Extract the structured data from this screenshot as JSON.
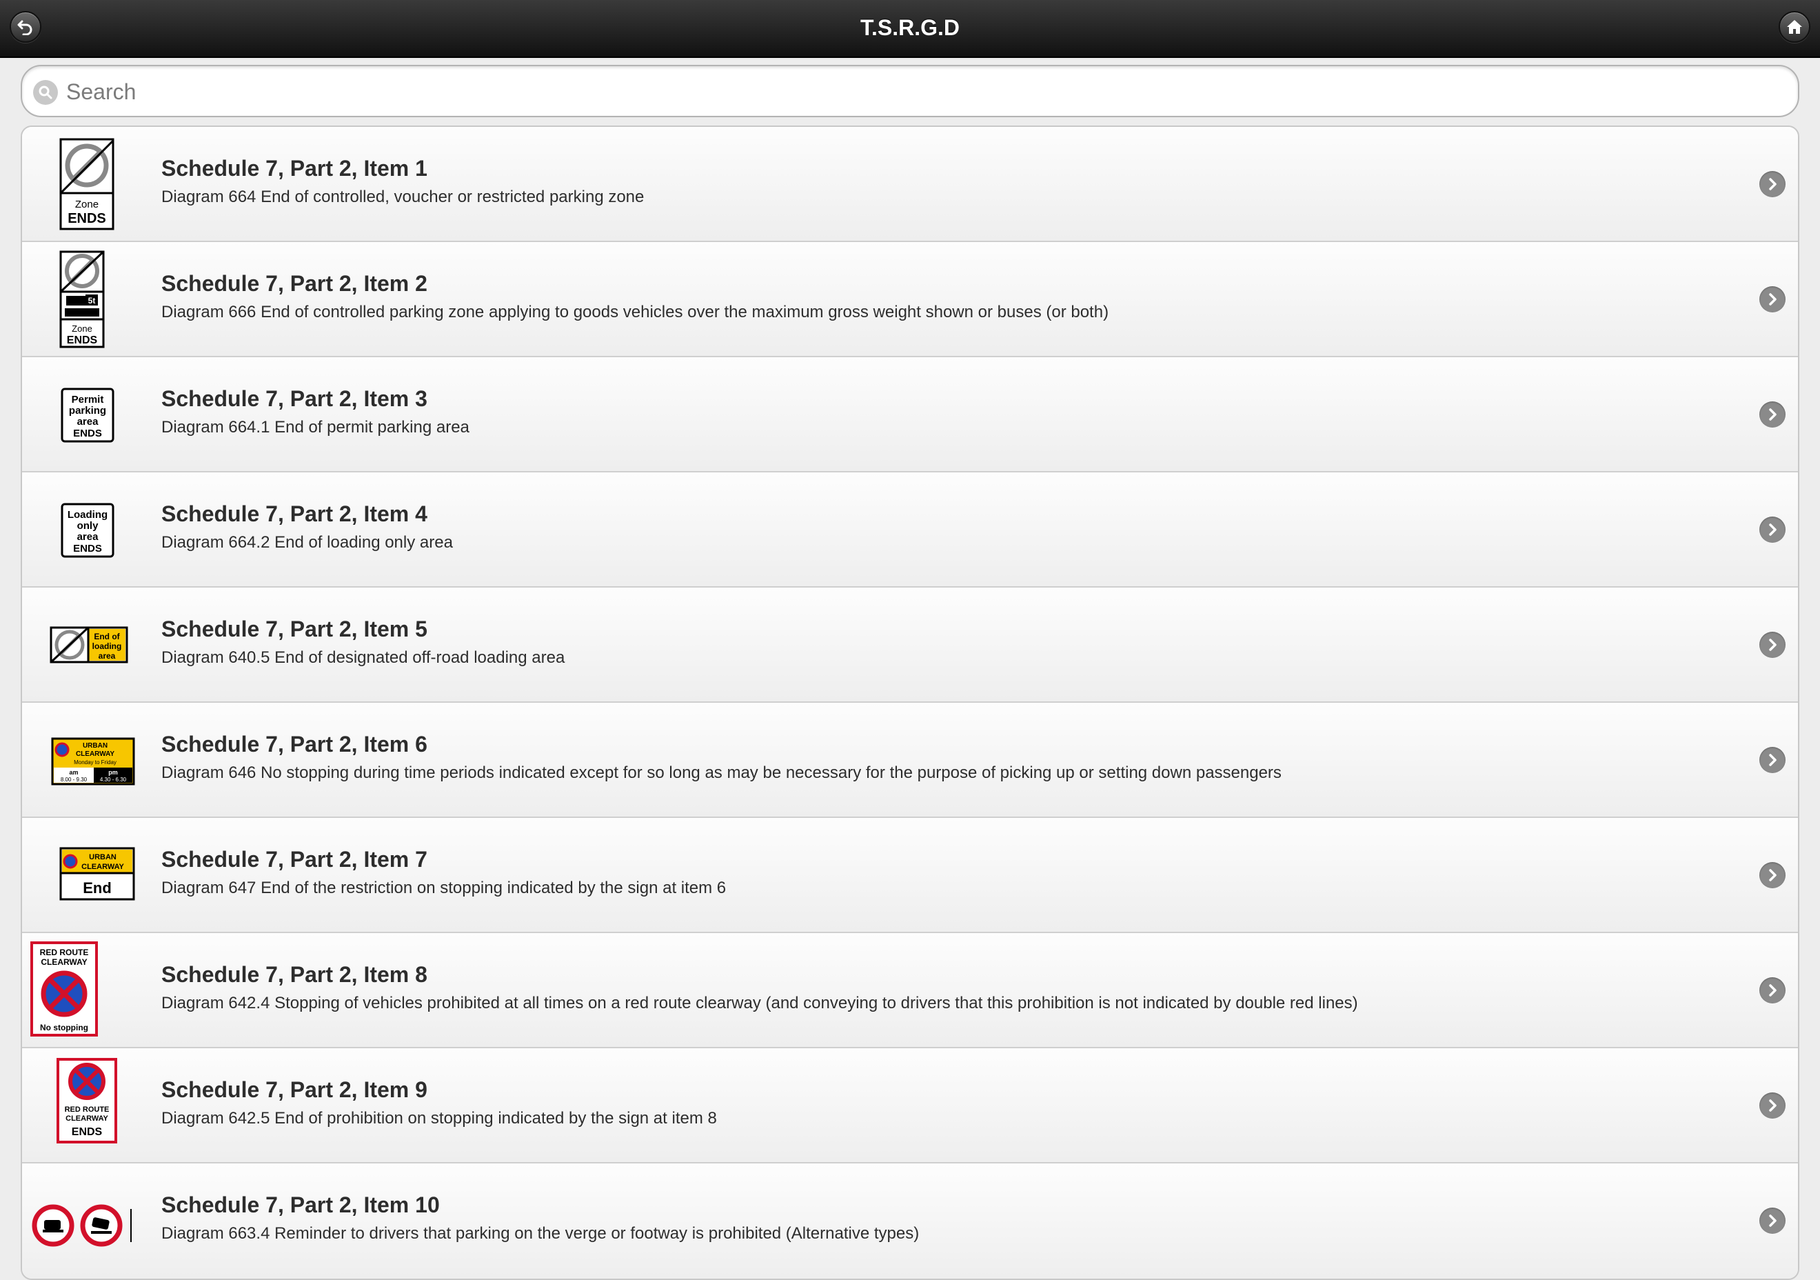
{
  "header": {
    "title": "T.S.R.G.D"
  },
  "search": {
    "placeholder": "Search"
  },
  "items": [
    {
      "title": "Schedule 7, Part 2, Item 1",
      "description": "Diagram 664 End of controlled, voucher or restricted parking zone",
      "sign_text": [
        "Zone",
        "ENDS"
      ]
    },
    {
      "title": "Schedule 7, Part 2, Item 2",
      "description": "Diagram 666 End of controlled parking zone applying to goods vehicles over the maximum gross weight shown or buses (or both)",
      "sign_text": [
        "5t",
        "Zone",
        "ENDS"
      ]
    },
    {
      "title": "Schedule 7, Part 2, Item 3",
      "description": "Diagram 664.1 End of permit parking area",
      "sign_text": [
        "Permit",
        "parking",
        "area",
        "ENDS"
      ]
    },
    {
      "title": "Schedule 7, Part 2, Item 4",
      "description": "Diagram 664.2 End of loading only area",
      "sign_text": [
        "Loading",
        "only",
        "area",
        "ENDS"
      ]
    },
    {
      "title": "Schedule 7, Part 2, Item 5",
      "description": "Diagram 640.5 End of designated off-road loading area",
      "sign_text": [
        "End of",
        "loading",
        "area"
      ]
    },
    {
      "title": "Schedule 7, Part 2, Item 6",
      "description": "Diagram 646 No stopping during time periods indicated except for so long as may be necessary for the purpose of picking up or setting down passengers",
      "sign_text": [
        "URBAN",
        "CLEARWAY",
        "Monday to Friday",
        "am",
        "pm",
        "8.00 - 9.30",
        "4.30 - 6.30"
      ]
    },
    {
      "title": "Schedule 7, Part 2, Item 7",
      "description": "Diagram 647 End of the restriction on stopping indicated by the sign at item 6",
      "sign_text": [
        "URBAN",
        "CLEARWAY",
        "End"
      ]
    },
    {
      "title": "Schedule 7, Part 2, Item 8",
      "description": "Diagram 642.4 Stopping of vehicles prohibited at all times on a red route clearway (and conveying to drivers that this prohibition is not indicated by double red lines)",
      "sign_text": [
        "RED ROUTE",
        "CLEARWAY",
        "No stopping"
      ]
    },
    {
      "title": "Schedule 7, Part 2, Item 9",
      "description": "Diagram 642.5 End of prohibition on stopping indicated by the sign at item 8",
      "sign_text": [
        "RED ROUTE",
        "CLEARWAY",
        "ENDS"
      ]
    },
    {
      "title": "Schedule 7, Part 2, Item 10",
      "description": "Diagram 663.4 Reminder to drivers that parking on the verge or footway is prohibited (Alternative types)",
      "sign_text": []
    }
  ],
  "colors": {
    "sign_yellow": "#f7c600",
    "sign_red": "#d2102a",
    "sign_blue": "#1f4fbf"
  }
}
